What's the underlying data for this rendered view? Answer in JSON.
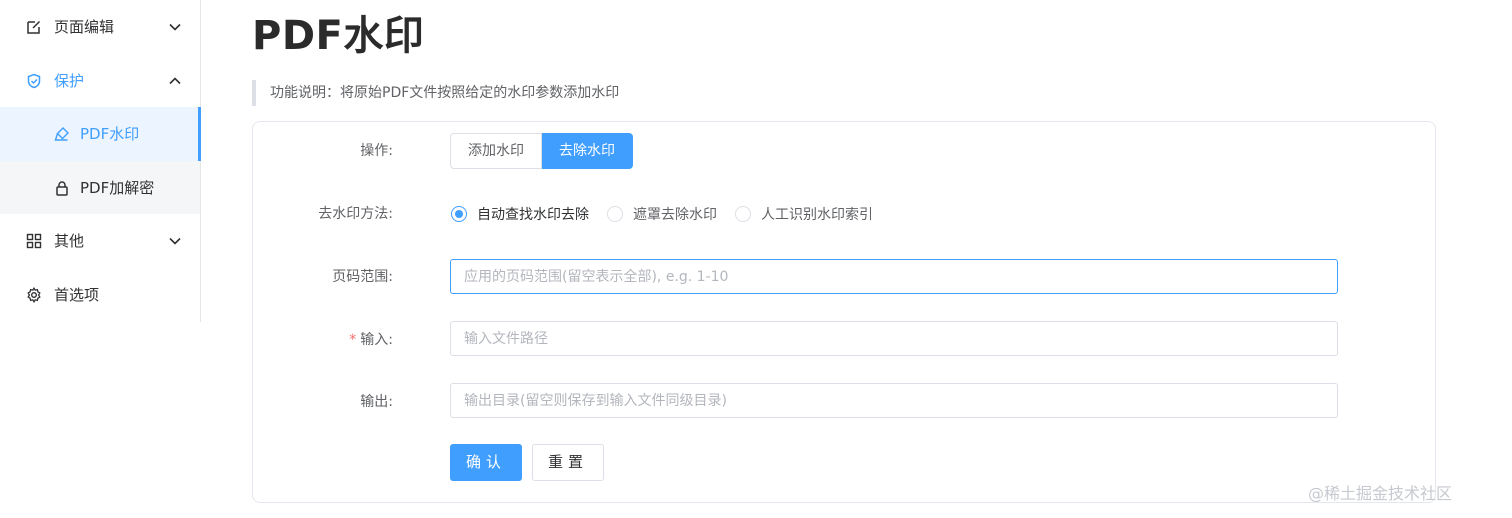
{
  "sidebar": {
    "items": [
      {
        "label": "页面编辑",
        "icon": "edit-icon",
        "chevron": "chevron-down-icon"
      },
      {
        "label": "保护",
        "icon": "shield-icon",
        "chevron": "chevron-up-icon"
      },
      {
        "label": "PDF水印",
        "icon": "brush-icon"
      },
      {
        "label": "PDF加解密",
        "icon": "lock-icon"
      },
      {
        "label": "其他",
        "icon": "grid-icon",
        "chevron": "chevron-down-icon"
      },
      {
        "label": "首选项",
        "icon": "gear-icon"
      }
    ]
  },
  "page": {
    "title": "PDF水印",
    "description": "功能说明：将原始PDF文件按照给定的水印参数添加水印"
  },
  "form": {
    "operation": {
      "label": "操作:",
      "options": [
        "添加水印",
        "去除水印"
      ],
      "selected": "去除水印"
    },
    "method": {
      "label": "去水印方法:",
      "options": [
        "自动查找水印去除",
        "遮罩去除水印",
        "人工识别水印索引"
      ],
      "selected": "自动查找水印去除"
    },
    "page_range": {
      "label": "页码范围:",
      "placeholder": "应用的页码范围(留空表示全部), e.g. 1-10",
      "value": ""
    },
    "input": {
      "required_mark": "*",
      "label": "输入:",
      "placeholder": "输入文件路径",
      "value": ""
    },
    "output": {
      "label": "输出:",
      "placeholder": "输出目录(留空则保存到输入文件同级目录)",
      "value": ""
    },
    "confirm_label": "确认",
    "reset_label": "重置"
  },
  "watermark": "@稀土掘金技术社区",
  "colors": {
    "accent": "#409eff",
    "required": "#f56c6c",
    "border": "#dcdfe6"
  }
}
